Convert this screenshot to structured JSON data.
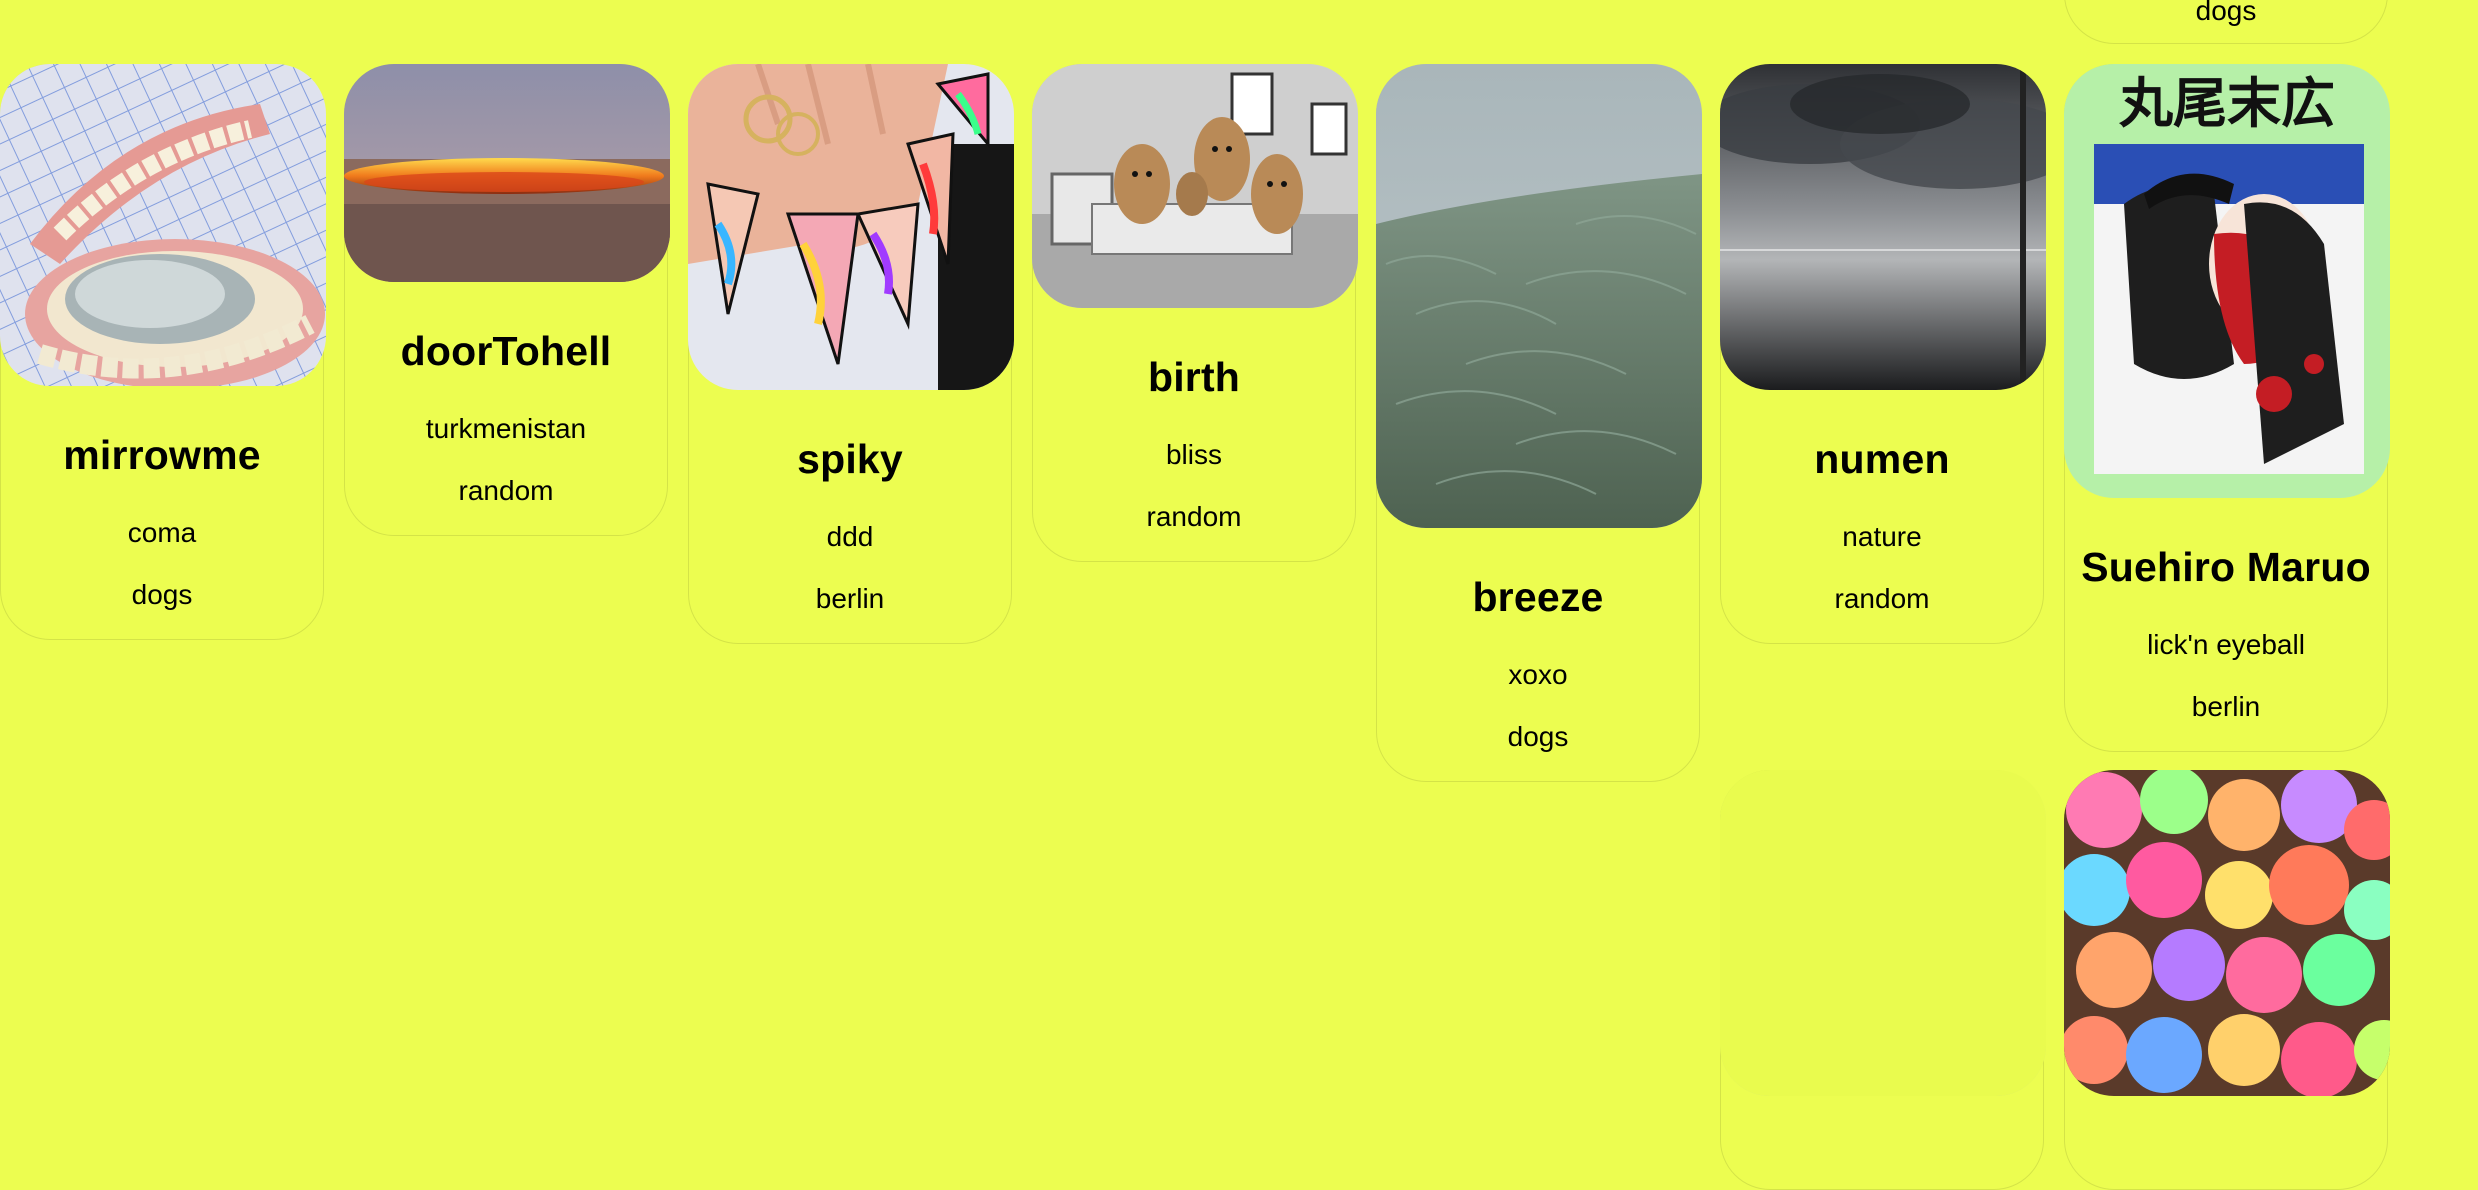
{
  "cards": [
    {
      "title": "mirrowme",
      "tag1": "coma",
      "tag2": "dogs",
      "image": "dentures-mirror-photo"
    },
    {
      "title": "doorTohell",
      "tag1": "turkmenistan",
      "tag2": "random",
      "image": "gas-crater-photo"
    },
    {
      "title": "spiky",
      "tag1": "ddd",
      "tag2": "berlin",
      "image": "psychedelic-nails-photo"
    },
    {
      "title": "birth",
      "tag1": "bliss",
      "tag2": "random",
      "image": "peanut-family-photo"
    },
    {
      "title": "breeze",
      "tag1": "xoxo",
      "tag2": "dogs",
      "image": "grass-field-render"
    },
    {
      "title": "numen",
      "tag1": "nature",
      "tag2": "random",
      "image": "stormy-sea-photo"
    },
    {
      "title": "Suehiro Maruo",
      "tag1": "lick'n eyeball",
      "tag2": "berlin",
      "image": "maruo-manga-cover",
      "image_text": "丸尾末広"
    },
    {
      "title": "",
      "tag1": "",
      "tag2": "",
      "image": "blank-yellow-image"
    },
    {
      "title": "",
      "tag1": "",
      "tag2": "",
      "image": "iridescent-blobs-render"
    }
  ],
  "partial_top_card": {
    "tag2": "dogs"
  },
  "colors": {
    "page_background": "#ecfd50"
  }
}
